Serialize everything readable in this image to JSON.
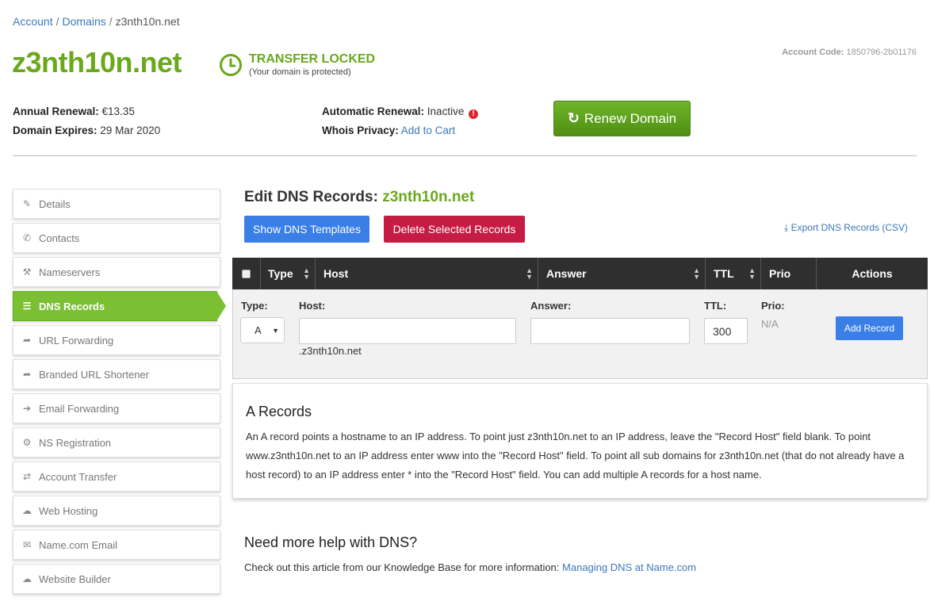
{
  "breadcrumb": {
    "account": "Account",
    "domains": "Domains",
    "current": "z3nth10n.net"
  },
  "domain": {
    "name": "z3nth10n.net",
    "lock_status": "TRANSFER LOCKED",
    "lock_sub": "(Your domain is protected)",
    "account_code_label": "Account Code:",
    "account_code": "1850796-2b01176"
  },
  "meta": {
    "annual_renewal_label": "Annual Renewal:",
    "annual_renewal_value": "€13.35",
    "expires_label": "Domain Expires:",
    "expires_value": "29 Mar 2020",
    "auto_renewal_label": "Automatic Renewal:",
    "auto_renewal_value": "Inactive",
    "whois_label": "Whois Privacy:",
    "whois_link": "Add to Cart",
    "renew_button": "Renew Domain"
  },
  "sidebar": {
    "items": [
      {
        "label": "Details",
        "icon": "pencil-icon"
      },
      {
        "label": "Contacts",
        "icon": "phone-icon"
      },
      {
        "label": "Nameservers",
        "icon": "wrench-icon"
      },
      {
        "label": "DNS Records",
        "icon": "list-icon",
        "active": true
      },
      {
        "label": "URL Forwarding",
        "icon": "share-icon"
      },
      {
        "label": "Branded URL Shortener",
        "icon": "share-icon"
      },
      {
        "label": "Email Forwarding",
        "icon": "arrow-right-icon"
      },
      {
        "label": "NS Registration",
        "icon": "gear-icon"
      },
      {
        "label": "Account Transfer",
        "icon": "transfer-icon"
      },
      {
        "label": "Web Hosting",
        "icon": "cloud-icon"
      },
      {
        "label": "Name.com Email",
        "icon": "envelope-icon"
      },
      {
        "label": "Website Builder",
        "icon": "cloud-upload-icon"
      }
    ]
  },
  "dns": {
    "title": "Edit DNS Records:",
    "domain": "z3nth10n.net",
    "show_templates": "Show DNS Templates",
    "delete_selected": "Delete Selected Records",
    "export": "Export DNS Records (CSV)",
    "columns": {
      "type": "Type",
      "host": "Host",
      "answer": "Answer",
      "ttl": "TTL",
      "prio": "Prio",
      "actions": "Actions"
    },
    "form": {
      "type_label": "Type:",
      "type_value": "A",
      "host_label": "Host:",
      "host_value": "",
      "host_suffix": ".z3nth10n.net",
      "answer_label": "Answer:",
      "answer_value": "",
      "ttl_label": "TTL:",
      "ttl_value": "300",
      "prio_label": "Prio:",
      "prio_value": "N/A",
      "add_button": "Add Record"
    }
  },
  "info": {
    "title": "A Records",
    "text": "An A record points a hostname to an IP address. To point just z3nth10n.net to an IP address, leave the \"Record Host\" field blank. To point www.z3nth10n.net to an IP address enter www into the \"Record Host\" field. To point all sub domains for z3nth10n.net (that do not already have a host record) to an IP address enter * into the \"Record Host\" field. You can add multiple A records for a host name."
  },
  "help": {
    "title": "Need more help with DNS?",
    "text": "Check out this article from our Knowledge Base for more information:",
    "link": "Managing DNS at Name.com"
  },
  "colors": {
    "brand_green": "#6aa81c",
    "primary_blue": "#3a7ee8",
    "danger_red": "#c61b43"
  }
}
